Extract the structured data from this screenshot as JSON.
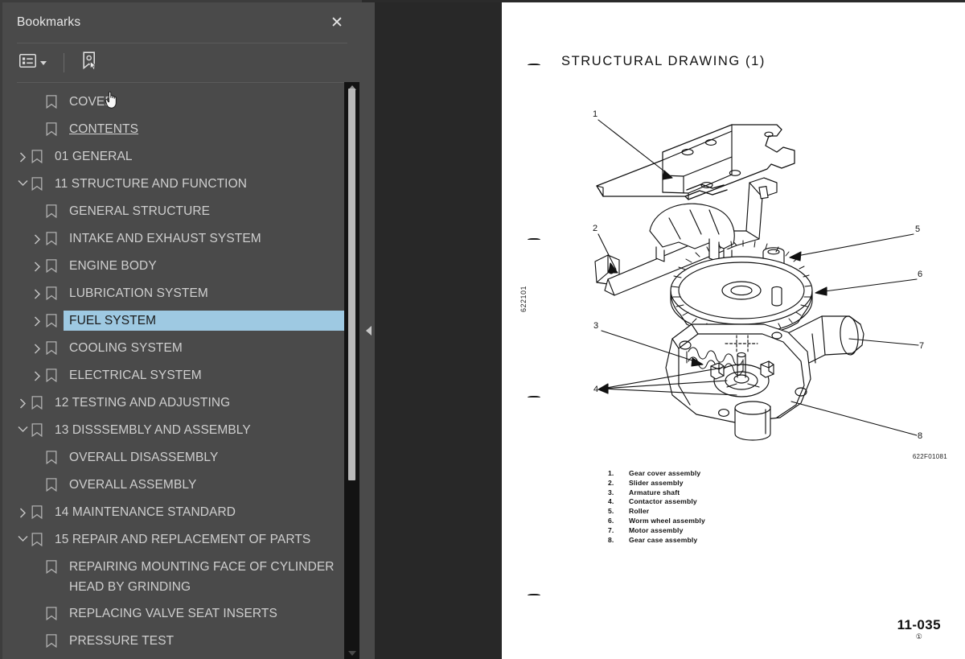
{
  "panel": {
    "title": "Bookmarks",
    "close_label": "✕",
    "toolbar": {
      "options_icon": "list-options-icon",
      "options_caret": "chevron-down-icon",
      "new_bookmark_icon": "bookmark-pointer-icon"
    },
    "items": [
      {
        "label": "COVER",
        "level": 1,
        "chevron": "none",
        "state": "normal"
      },
      {
        "label": "CONTENTS",
        "level": 1,
        "chevron": "none",
        "state": "hovered"
      },
      {
        "label": "01 GENERAL",
        "level": 0,
        "chevron": "collapsed",
        "state": "normal"
      },
      {
        "label": "11 STRUCTURE AND FUNCTION",
        "level": 0,
        "chevron": "expanded",
        "state": "normal"
      },
      {
        "label": "GENERAL STRUCTURE",
        "level": 1,
        "chevron": "none",
        "state": "normal"
      },
      {
        "label": "INTAKE AND EXHAUST SYSTEM",
        "level": 1,
        "chevron": "collapsed",
        "state": "normal"
      },
      {
        "label": "ENGINE BODY",
        "level": 1,
        "chevron": "collapsed",
        "state": "normal"
      },
      {
        "label": "LUBRICATION SYSTEM",
        "level": 1,
        "chevron": "collapsed",
        "state": "normal"
      },
      {
        "label": "FUEL SYSTEM",
        "level": 1,
        "chevron": "collapsed",
        "state": "selected"
      },
      {
        "label": "COOLING SYSTEM",
        "level": 1,
        "chevron": "collapsed",
        "state": "normal"
      },
      {
        "label": "ELECTRICAL SYSTEM",
        "level": 1,
        "chevron": "collapsed",
        "state": "normal"
      },
      {
        "label": "12 TESTING AND ADJUSTING",
        "level": 0,
        "chevron": "collapsed",
        "state": "normal"
      },
      {
        "label": "13 DISSSEMBLY AND ASSEMBLY",
        "level": 0,
        "chevron": "expanded",
        "state": "normal"
      },
      {
        "label": "OVERALL DISASSEMBLY",
        "level": 1,
        "chevron": "none",
        "state": "normal"
      },
      {
        "label": "OVERALL ASSEMBLY",
        "level": 1,
        "chevron": "none",
        "state": "normal"
      },
      {
        "label": "14 MAINTENANCE STANDARD",
        "level": 0,
        "chevron": "collapsed",
        "state": "normal"
      },
      {
        "label": "15 REPAIR AND REPLACEMENT OF PARTS",
        "level": 0,
        "chevron": "expanded",
        "state": "normal"
      },
      {
        "label": "REPAIRING MOUNTING FACE OF CYLINDER HEAD BY GRINDING",
        "level": 1,
        "chevron": "none",
        "state": "normal"
      },
      {
        "label": "REPLACING VALVE SEAT INSERTS",
        "level": 1,
        "chevron": "none",
        "state": "normal"
      },
      {
        "label": "PRESSURE TEST",
        "level": 1,
        "chevron": "none",
        "state": "normal"
      }
    ]
  },
  "collapse_strip": {
    "icon": "triangle-left-icon"
  },
  "page": {
    "title": "STRUCTURAL DRAWING (1)",
    "side_code": "622101",
    "figure_code": "622F01081",
    "page_number": "11-035",
    "page_sub": "①",
    "callouts": [
      "1",
      "2",
      "3",
      "4",
      "5",
      "6",
      "7",
      "8"
    ],
    "legend": [
      {
        "num": "1.",
        "text": "Gear cover assembly"
      },
      {
        "num": "2.",
        "text": "Slider assembly"
      },
      {
        "num": "3.",
        "text": "Armature shaft"
      },
      {
        "num": "4.",
        "text": "Contactor assembly"
      },
      {
        "num": "5.",
        "text": "Roller"
      },
      {
        "num": "6.",
        "text": "Worm wheel assembly"
      },
      {
        "num": "7.",
        "text": "Motor assembly"
      },
      {
        "num": "8.",
        "text": "Gear case assembly"
      }
    ]
  },
  "colors": {
    "panel_bg": "#4a4a4a",
    "viewer_bg": "#282828",
    "selection": "#9ec9e2",
    "text": "#cfcfcf",
    "page_bg": "#ffffff"
  }
}
